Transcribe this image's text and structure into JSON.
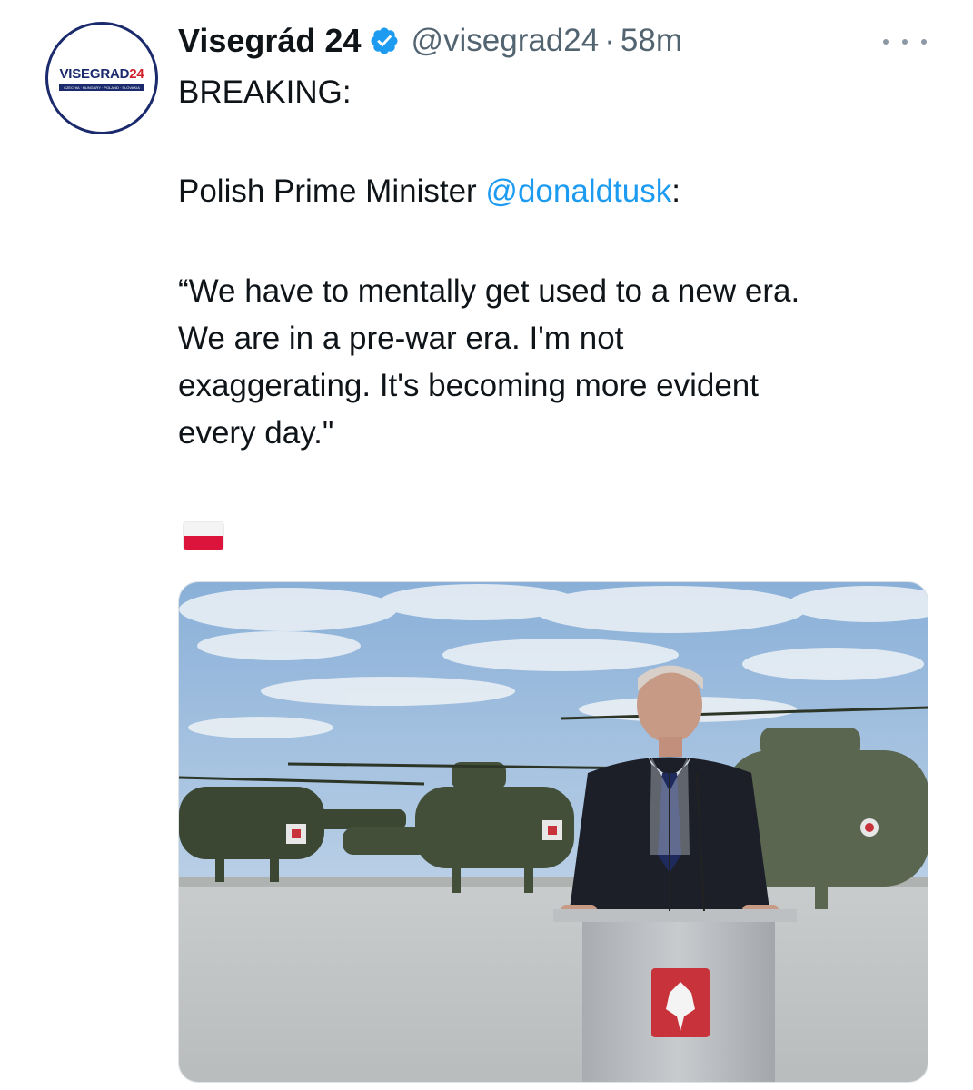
{
  "tweet": {
    "avatar": {
      "brand": "VISEGRAD",
      "brand_num": "24",
      "strip": "CZECHIA · HUNGARY · POLAND · SLOVAKIA"
    },
    "display_name": "Visegrád 24",
    "verified_icon": "verified-badge-icon",
    "handle": "@visegrad24",
    "separator": "·",
    "time": "58m",
    "more_icon": "more-options-icon",
    "text": {
      "breaking": "BREAKING:",
      "pm_prefix": "Polish Prime Minister ",
      "mention": "@donaldtusk",
      "pm_suffix": ":",
      "quote_lines": [
        "“We have to mentally get used to a new era.",
        "We are in a pre-war era. I'm not",
        "exaggerating. It's becoming more evident",
        "every day.\""
      ]
    },
    "flag_emoji": "Poland flag",
    "colors": {
      "link": "#1d9bf0",
      "muted": "#536471",
      "verified": "#1d9bf0"
    }
  }
}
